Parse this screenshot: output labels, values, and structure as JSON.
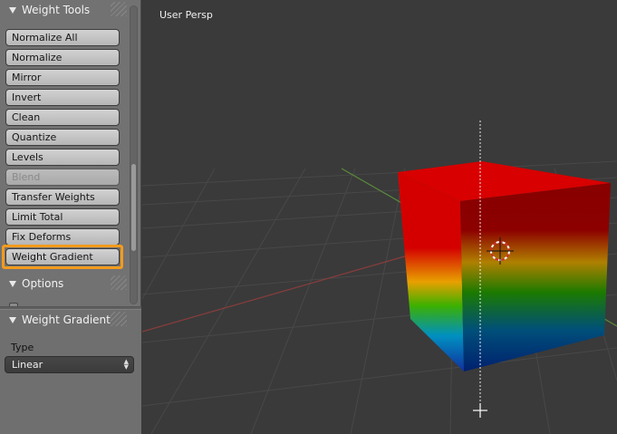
{
  "tool_shelf": {
    "weight_tools_header": "Weight Tools",
    "buttons": [
      {
        "label": "Normalize All",
        "enabled": true
      },
      {
        "label": "Normalize",
        "enabled": true
      },
      {
        "label": "Mirror",
        "enabled": true
      },
      {
        "label": "Invert",
        "enabled": true
      },
      {
        "label": "Clean",
        "enabled": true
      },
      {
        "label": "Quantize",
        "enabled": true
      },
      {
        "label": "Levels",
        "enabled": true
      },
      {
        "label": "Blend",
        "enabled": false
      },
      {
        "label": "Transfer Weights",
        "enabled": true
      },
      {
        "label": "Limit Total",
        "enabled": true
      },
      {
        "label": "Fix Deforms",
        "enabled": true
      },
      {
        "label": "Weight Gradient",
        "enabled": true,
        "highlighted": true
      }
    ],
    "options_header": "Options"
  },
  "operator_panel": {
    "header": "Weight Gradient",
    "type_label": "Type",
    "type_value": "Linear"
  },
  "viewport": {
    "view_label": "User Persp",
    "highlight_color": "#f29b1d",
    "gradient_colors": [
      "#d40000",
      "#e8a000",
      "#3cb000",
      "#0090c0",
      "#00208c"
    ]
  }
}
